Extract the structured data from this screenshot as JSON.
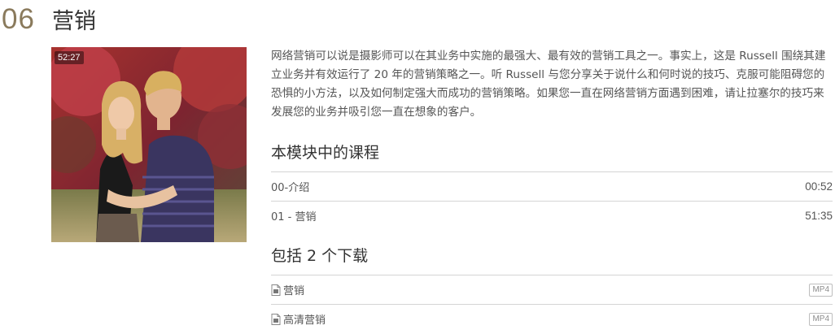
{
  "module": {
    "number": "06",
    "title": "营销",
    "video_duration": "52:27",
    "description": "网络营销可以说是摄影师可以在其业务中实施的最强大、最有效的营销工具之一。事实上，这是 Russell 围绕其建立业务并有效运行了 20 年的营销策略之一。听 Russell 与您分享关于说什么和何时说的技巧、克服可能阻碍您的恐惧的小方法，以及如何制定强大而成功的营销策略。如果您一直在网络营销方面遇到困难，请让拉塞尔的技巧来发展您的业务并吸引您一直在想象的客户。"
  },
  "lessons": {
    "heading": "本模块中的课程",
    "items": [
      {
        "title": "00-介绍",
        "duration": "00:52"
      },
      {
        "title": "01 - 营销",
        "duration": "51:35"
      }
    ]
  },
  "downloads": {
    "heading": "包括 2 个下载",
    "items": [
      {
        "name": "营销",
        "format": "MP4",
        "icon": "file-icon"
      },
      {
        "name": "高清营销",
        "format": "MP4",
        "icon": "file-icon"
      }
    ]
  },
  "colors": {
    "module_number": "#8a7a5c",
    "divider": "#d4d4d4",
    "text": "#555555"
  }
}
